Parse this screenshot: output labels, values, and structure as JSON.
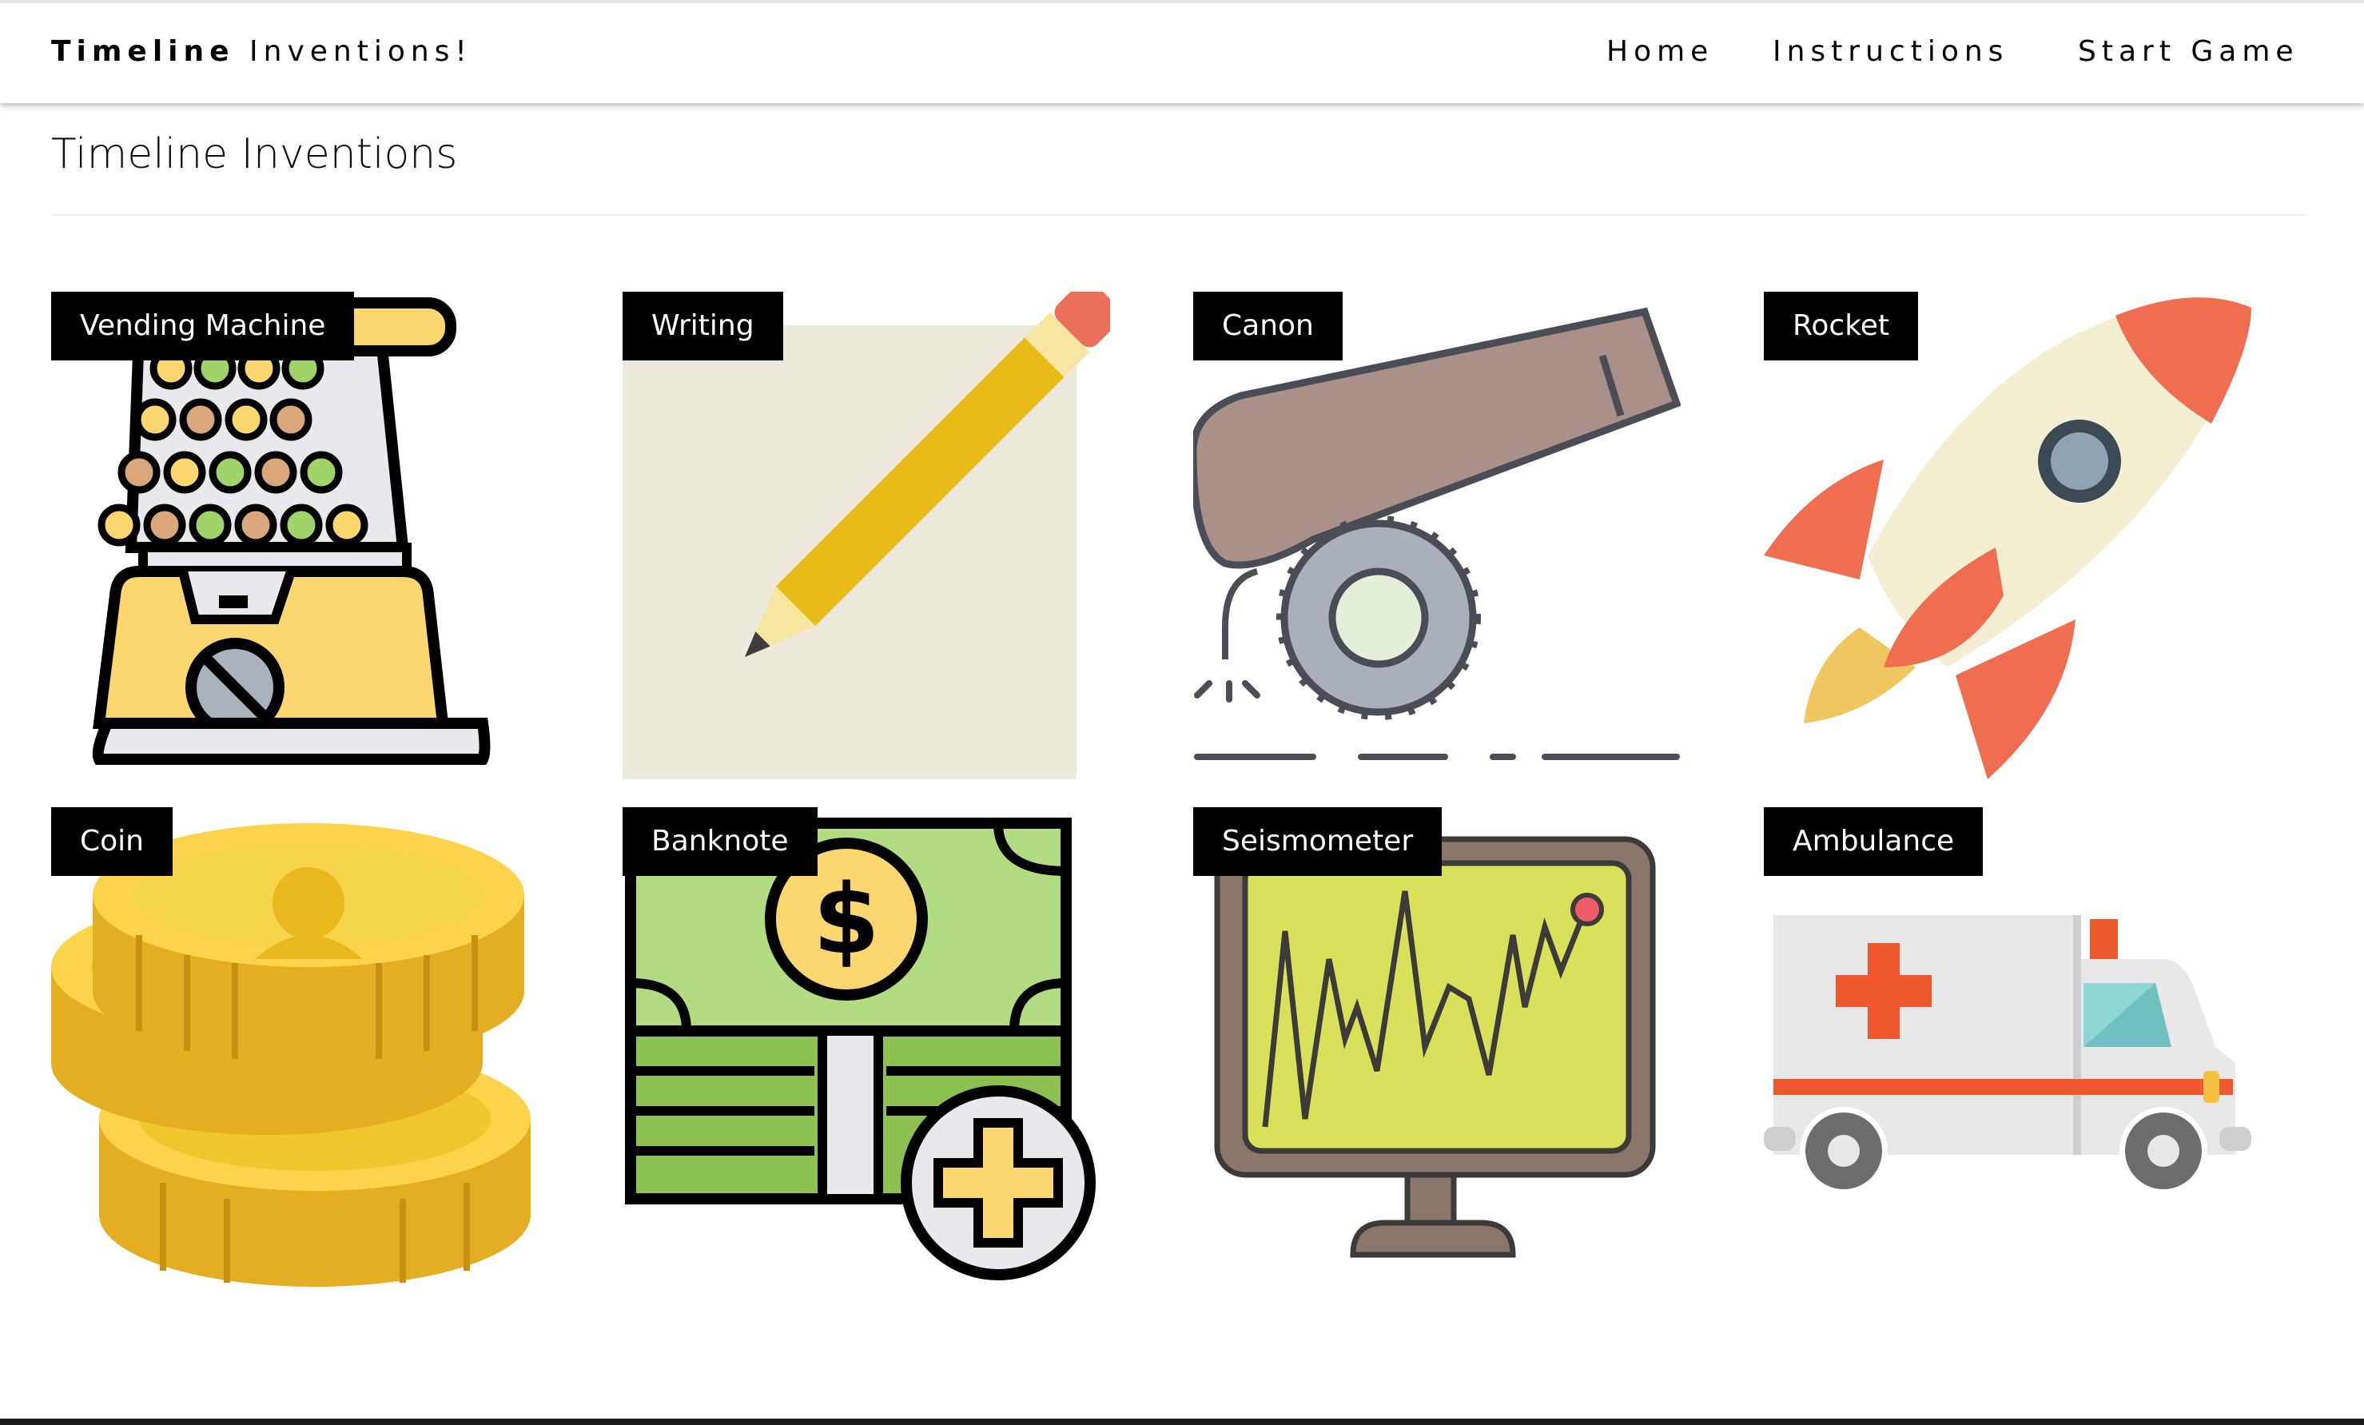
{
  "brand": {
    "bold": "Timeline",
    "rest": "Inventions!"
  },
  "nav": {
    "home": "Home",
    "instructions": "Instructions",
    "start": "Start Game"
  },
  "page_title": "Timeline Inventions",
  "cards": [
    {
      "label": "Vending Machine",
      "icon": "gumball-machine-icon"
    },
    {
      "label": "Writing",
      "icon": "pencil-icon"
    },
    {
      "label": "Canon",
      "icon": "cannon-icon"
    },
    {
      "label": "Rocket",
      "icon": "rocket-icon"
    },
    {
      "label": "Coin",
      "icon": "coins-icon"
    },
    {
      "label": "Banknote",
      "icon": "banknote-icon"
    },
    {
      "label": "Seismometer",
      "icon": "seismometer-icon"
    },
    {
      "label": "Ambulance",
      "icon": "ambulance-icon"
    }
  ]
}
